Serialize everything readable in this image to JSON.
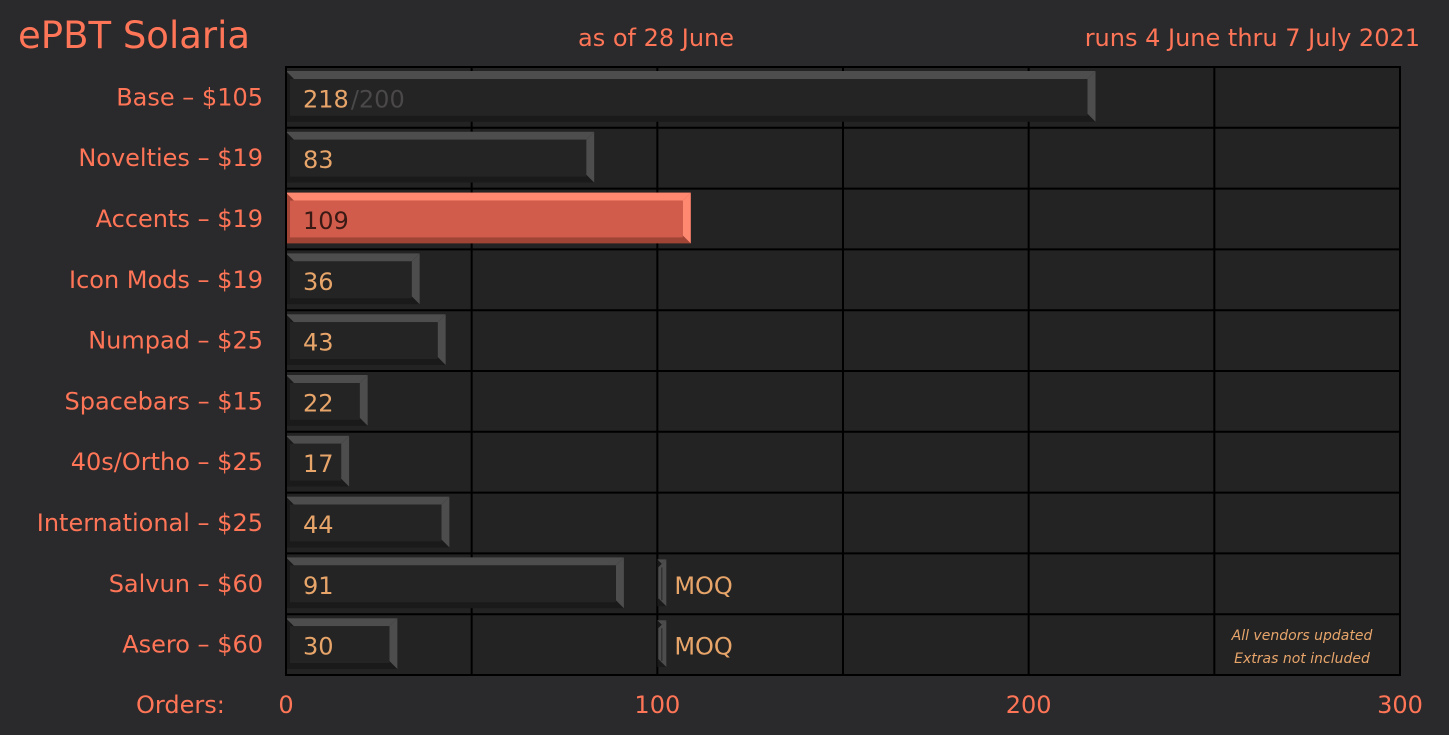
{
  "header": {
    "title": "ePBT Solaria",
    "subtitle": "as of 28 June",
    "run_dates": "runs 4 June thru 7 July 2021"
  },
  "chart_data": {
    "type": "bar",
    "orientation": "horizontal",
    "categories": [
      "Base – $105",
      "Novelties – $19",
      "Accents – $19",
      "Icon Mods – $19",
      "Numpad – $25",
      "Spacebars – $15",
      "40s/Ortho – $25",
      "International – $25",
      "Salvun – $60",
      "Asero – $60"
    ],
    "values": [
      218,
      83,
      109,
      36,
      43,
      22,
      17,
      44,
      91,
      30
    ],
    "value_labels": [
      "218",
      "83",
      "109",
      "36",
      "43",
      "22",
      "17",
      "44",
      "91",
      "30"
    ],
    "highlight_index": 2,
    "base_target": {
      "value": 200,
      "label": "/200"
    },
    "moq": {
      "value": 100,
      "label": "MOQ",
      "rows": [
        8,
        9
      ]
    },
    "xlabel": "Orders:",
    "xlim": [
      0,
      300
    ],
    "xticks": [
      0,
      100,
      200,
      300
    ],
    "grid": true,
    "note": [
      "All vendors updated",
      "Extras not included"
    ],
    "colors": {
      "background": "#2a292b",
      "plot_background": "#232324",
      "gridline": "#000000",
      "text_accent": "#ff7557",
      "value_text": "#e8a56a",
      "target_text": "#4a4848",
      "bar_face": "#242424",
      "bar_edge": "#4d4d4d",
      "bar_edge_dark": "#1a1a1a",
      "highlight_face": "#d15c4c",
      "highlight_edge": "#ff8870",
      "highlight_edge_dark": "#a04436",
      "highlight_value_text": "#3a1a14"
    }
  }
}
